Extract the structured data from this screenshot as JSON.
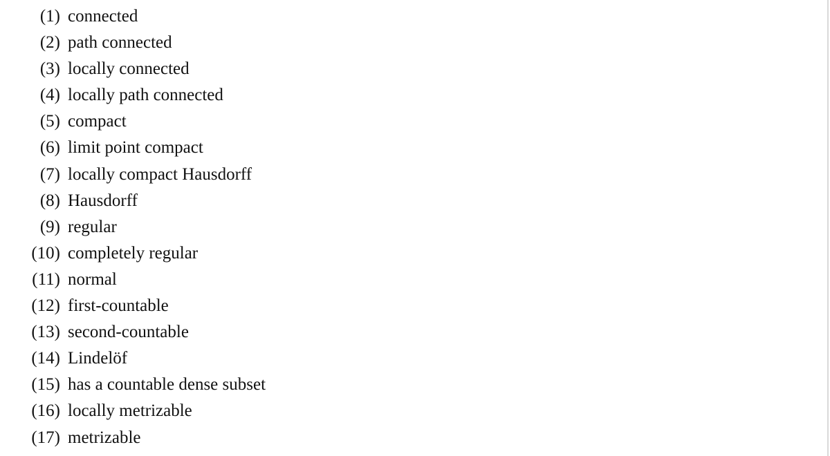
{
  "document": {
    "properties": [
      {
        "number": "(1)",
        "label": "connected"
      },
      {
        "number": "(2)",
        "label": "path connected"
      },
      {
        "number": "(3)",
        "label": "locally connected"
      },
      {
        "number": "(4)",
        "label": "locally path connected"
      },
      {
        "number": "(5)",
        "label": "compact"
      },
      {
        "number": "(6)",
        "label": "limit point compact"
      },
      {
        "number": "(7)",
        "label": "locally compact Hausdorff"
      },
      {
        "number": "(8)",
        "label": "Hausdorff"
      },
      {
        "number": "(9)",
        "label": "regular"
      },
      {
        "number": "(10)",
        "label": "completely regular"
      },
      {
        "number": "(11)",
        "label": "normal"
      },
      {
        "number": "(12)",
        "label": "first-countable"
      },
      {
        "number": "(13)",
        "label": "second-countable"
      },
      {
        "number": "(14)",
        "label": "Lindelöf"
      },
      {
        "number": "(15)",
        "label": "has a countable dense subset"
      },
      {
        "number": "(16)",
        "label": "locally metrizable"
      },
      {
        "number": "(17)",
        "label": "metrizable"
      }
    ]
  }
}
